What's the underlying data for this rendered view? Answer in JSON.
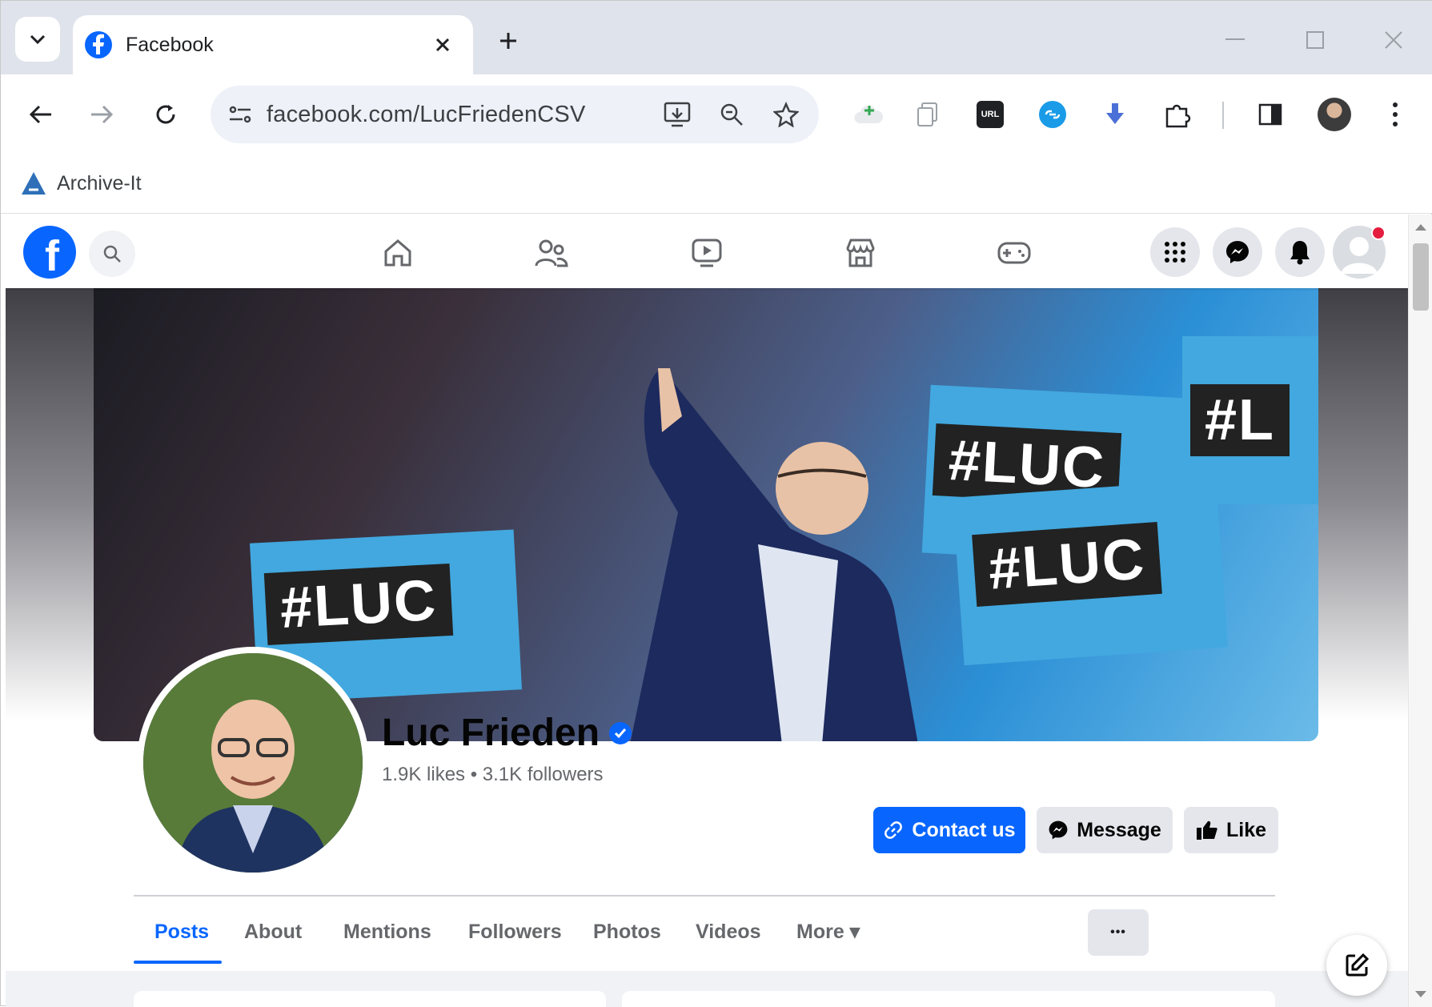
{
  "browser": {
    "tab_title": "Facebook",
    "url": "facebook.com/LucFriedenCSV",
    "bookmark_label": "Archive-It",
    "ext_url_badge": "URL"
  },
  "facebook": {
    "logo_letter": "f",
    "profile": {
      "name": "Luc Frieden",
      "stats": "1.9K likes • 3.1K followers"
    },
    "buttons": {
      "contact": "Contact us",
      "message": "Message",
      "like": "Like",
      "more_dots": "•••"
    },
    "tabs": [
      {
        "label": "Posts",
        "active": true
      },
      {
        "label": "About"
      },
      {
        "label": "Mentions"
      },
      {
        "label": "Followers"
      },
      {
        "label": "Photos"
      },
      {
        "label": "Videos"
      },
      {
        "label": "More ▾"
      }
    ],
    "cover_signs": [
      "#LUC",
      "#LUC",
      "#LUC",
      "#L"
    ]
  },
  "colors": {
    "facebook_blue": "#0866ff",
    "notification_red": "#e41e3f",
    "tabstrip": "#dfe3eb"
  }
}
